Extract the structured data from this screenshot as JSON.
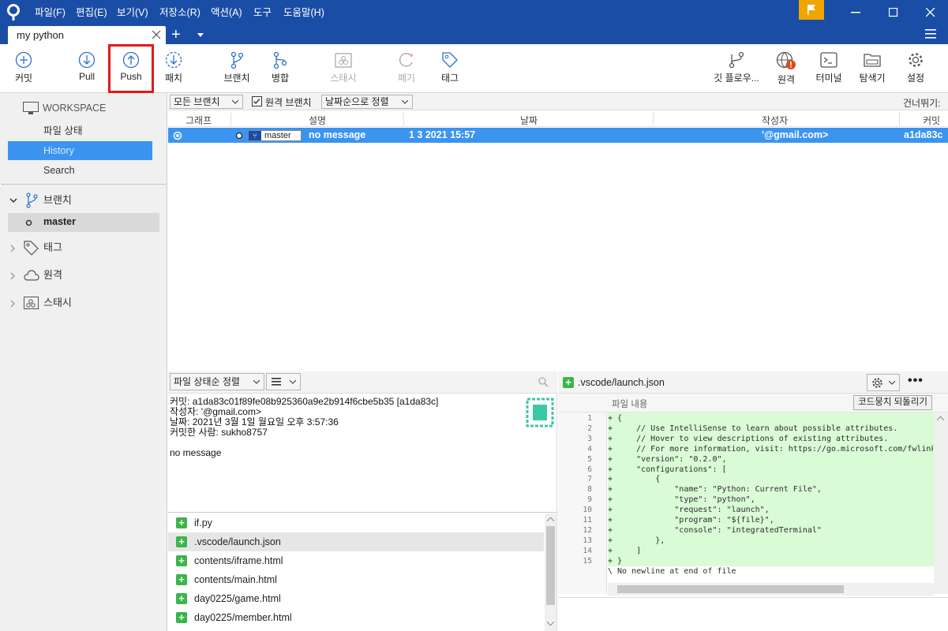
{
  "app": {
    "tab_title": "my python",
    "flag_color": "#f0a500",
    "brand_color": "#1a4ea6"
  },
  "menu": [
    "파일(F)",
    "편집(E)",
    "보기(V)",
    "저장소(R)",
    "액션(A)",
    "도구",
    "도움말(H)"
  ],
  "toolbar": {
    "commit": "커밋",
    "pull": "Pull",
    "push": "Push",
    "fetch": "패치",
    "branch": "브랜치",
    "merge": "병합",
    "stash": "스태시",
    "discard": "폐기",
    "tag": "태그",
    "gitflow": "깃 플로우...",
    "remote": "원격",
    "terminal": "터미널",
    "explorer": "탐색기",
    "settings": "설정"
  },
  "sidebar": {
    "workspace": "WORKSPACE",
    "file_status": "파일 상태",
    "history": "History",
    "search": "Search",
    "branches": "브랜치",
    "master": "master",
    "tags": "태그",
    "remotes": "원격",
    "stashes": "스태시"
  },
  "log": {
    "all_branches": "모든 브랜치",
    "remote_branches": "원격 브랜치",
    "sort": "날짜순으로 정렬",
    "jump": "건너뛰기:",
    "cols": {
      "graph": "그래프",
      "desc": "설명",
      "date": "날짜",
      "author": "작성자",
      "commit": "커밋"
    },
    "row": {
      "branch": "master",
      "message": "no message",
      "date": "1 3 2021 15:57",
      "author": "'@gmail.com>",
      "hash": "a1da83c"
    }
  },
  "details": {
    "sort_label": "파일 상태순 정렬",
    "commit_line": "커밋: a1da83c01f89fe08b925360a9e2b914f6cbe5b35 [a1da83c]",
    "author_line": "작성자:                                  '@gmail.com>",
    "date_line": "날짜: 2021년 3월 1일 월요일 오후 3:57:36",
    "committer_line": "커밋한 사람: sukho8757",
    "message": "no message"
  },
  "files": [
    "if.py",
    ".vscode/launch.json",
    "contents/iframe.html",
    "contents/main.html",
    "day0225/game.html",
    "day0225/member.html"
  ],
  "diff": {
    "file": ".vscode/launch.json",
    "content_label": "파일 내용",
    "revert": "코드뭉치 되돌리기",
    "lines": [
      "+ {",
      "+     // Use IntelliSense to learn about possible attributes.",
      "+     // Hover to view descriptions of existing attributes.",
      "+     // For more information, visit: https://go.microsoft.com/fwlink/?linkid=830387",
      "+     \"version\": \"0.2.0\",",
      "+     \"configurations\": [",
      "+         {",
      "+             \"name\": \"Python: Current File\",",
      "+             \"type\": \"python\",",
      "+             \"request\": \"launch\",",
      "+             \"program\": \"${file}\",",
      "+             \"console\": \"integratedTerminal\"",
      "+         },",
      "+     ]",
      "+ }"
    ],
    "line_numbers": [
      "1",
      "2",
      "3",
      "4",
      "5",
      "6",
      "7",
      "8",
      "9",
      "10",
      "11",
      "12",
      "13",
      "14",
      "15"
    ],
    "no_newline": "\\ No newline at end of file"
  }
}
